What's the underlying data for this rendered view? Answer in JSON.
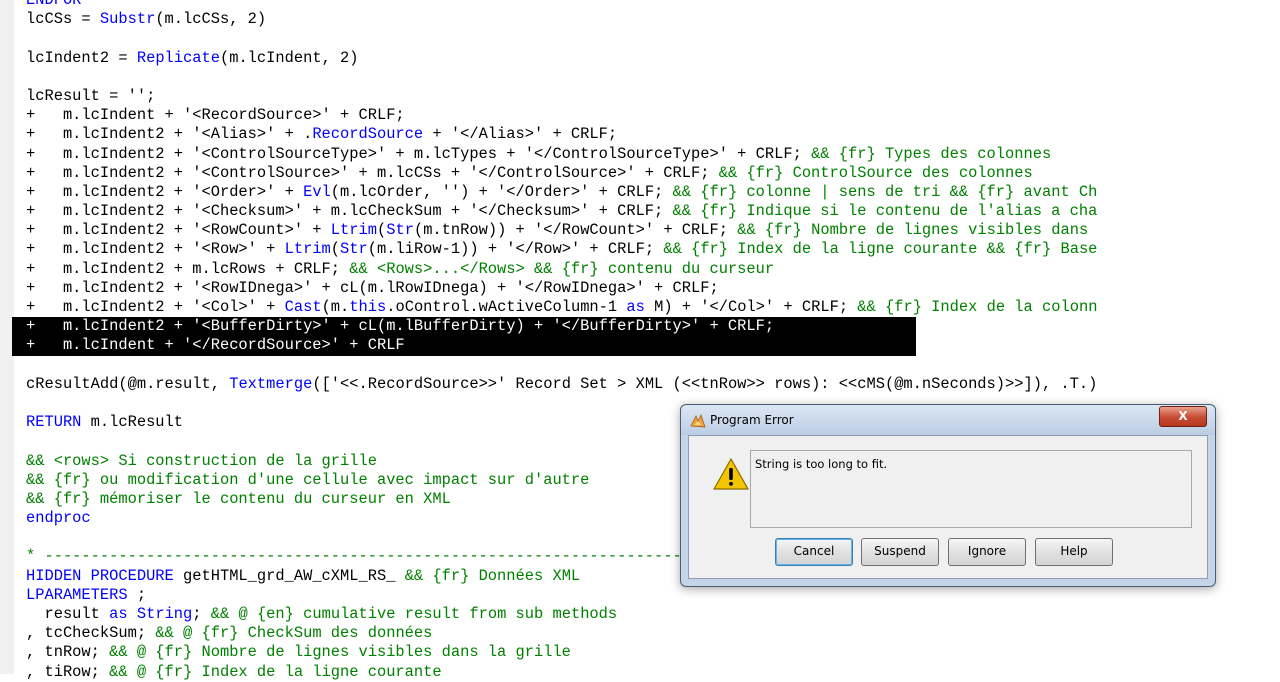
{
  "code_lines": [
    [
      {
        "t": "ENDFOR",
        "c": "kw"
      }
    ],
    [
      {
        "t": "lcCSs = "
      },
      {
        "t": "Substr",
        "c": "kw"
      },
      {
        "t": "(m.lcCSs, 2)"
      }
    ],
    [
      {
        "t": ""
      }
    ],
    [
      {
        "t": "lcIndent2 = "
      },
      {
        "t": "Replicate",
        "c": "kw"
      },
      {
        "t": "(m.lcIndent, 2)"
      }
    ],
    [
      {
        "t": ""
      }
    ],
    [
      {
        "t": "lcResult = '';"
      }
    ],
    [
      {
        "t": "+   m.lcIndent + '<RecordSource>' + CRLF;"
      }
    ],
    [
      {
        "t": "+   m.lcIndent2 + '<Alias>' + ."
      },
      {
        "t": "RecordSource",
        "c": "kw"
      },
      {
        "t": " + '</Alias>' + CRLF;"
      }
    ],
    [
      {
        "t": "+   m.lcIndent2 + '<ControlSourceType>' + m.lcTypes + '</ControlSourceType>' + CRLF; "
      },
      {
        "t": "&& {fr} Types des colonnes",
        "c": "cm"
      }
    ],
    [
      {
        "t": "+   m.lcIndent2 + '<ControlSource>' + m.lcCSs + '</ControlSource>' + CRLF; "
      },
      {
        "t": "&& {fr} ControlSource des colonnes",
        "c": "cm"
      }
    ],
    [
      {
        "t": "+   m.lcIndent2 + '<Order>' + "
      },
      {
        "t": "Evl",
        "c": "kw"
      },
      {
        "t": "(m.lcOrder, '') + '</Order>' + CRLF; "
      },
      {
        "t": "&& {fr} colonne | sens de tri && {fr} avant Ch",
        "c": "cm"
      }
    ],
    [
      {
        "t": "+   m.lcIndent2 + '<Checksum>' + m.lcCheckSum + '</Checksum>' + CRLF; "
      },
      {
        "t": "&& {fr} Indique si le contenu de l'alias a cha",
        "c": "cm"
      }
    ],
    [
      {
        "t": "+   m.lcIndent2 + '<RowCount>' + "
      },
      {
        "t": "Ltrim",
        "c": "kw"
      },
      {
        "t": "("
      },
      {
        "t": "Str",
        "c": "kw"
      },
      {
        "t": "(m.tnRow)) + '</RowCount>' + CRLF; "
      },
      {
        "t": "&& {fr} Nombre de lignes visibles dans",
        "c": "cm"
      }
    ],
    [
      {
        "t": "+   m.lcIndent2 + '<Row>' + "
      },
      {
        "t": "Ltrim",
        "c": "kw"
      },
      {
        "t": "("
      },
      {
        "t": "Str",
        "c": "kw"
      },
      {
        "t": "(m.liRow-1)) + '</Row>' + CRLF; "
      },
      {
        "t": "&& {fr} Index de la ligne courante && {fr} Base",
        "c": "cm"
      }
    ],
    [
      {
        "t": "+   m.lcIndent2 + m.lcRows + CRLF; "
      },
      {
        "t": "&& <Rows>...</Rows> && {fr} contenu du curseur",
        "c": "cm"
      }
    ],
    [
      {
        "t": "+   m.lcIndent2 + '<RowIDnega>' + cL(m.lRowIDnega) + '</RowIDnega>' + CRLF;"
      }
    ],
    [
      {
        "t": "+   m.lcIndent2 + '<Col>' + "
      },
      {
        "t": "Cast",
        "c": "kw"
      },
      {
        "t": "(m."
      },
      {
        "t": "this",
        "c": "kw"
      },
      {
        "t": ".oControl.wActiveColumn-1 "
      },
      {
        "t": "as",
        "c": "kw"
      },
      {
        "t": " M) + '</Col>' + CRLF; "
      },
      {
        "t": "&& {fr} Index de la colonn",
        "c": "cm"
      }
    ],
    [
      {
        "t": "+   m.lcIndent2 + '<BufferDirty>' + cL(m.lBufferDirty) + '</BufferDirty>' + CRLF;",
        "sel": true
      }
    ],
    [
      {
        "t": "+   m.lcIndent + '</RecordSource>' + CRLF",
        "sel": true
      }
    ],
    [
      {
        "t": ""
      }
    ],
    [
      {
        "t": "cResultAdd(@m.result, "
      },
      {
        "t": "Textmerge",
        "c": "kw"
      },
      {
        "t": "(['<<.RecordSource>>' Record Set > XML (<<tnRow>> rows): <<cMS(@m.nSeconds)>>]), .T.)"
      }
    ],
    [
      {
        "t": ""
      }
    ],
    [
      {
        "t": "RETURN",
        "c": "kw"
      },
      {
        "t": " m.lcResult"
      }
    ],
    [
      {
        "t": ""
      }
    ],
    [
      {
        "t": "&& <rows> Si construction de la grille",
        "c": "cm"
      }
    ],
    [
      {
        "t": "&& {fr} ou modification d'une cellule avec impact sur d'autre",
        "c": "cm"
      }
    ],
    [
      {
        "t": "&& {fr} mémoriser le contenu du curseur en XML",
        "c": "cm"
      }
    ],
    [
      {
        "t": "endproc",
        "c": "kw"
      }
    ],
    [
      {
        "t": ""
      }
    ],
    [
      {
        "t": "* -----------------------------------------------------------------------",
        "c": "cm"
      }
    ],
    [
      {
        "t": "HIDDEN PROCEDURE",
        "c": "kw"
      },
      {
        "t": " getHTML_grd_AW_cXML_RS_ "
      },
      {
        "t": "&& {fr} Données XML",
        "c": "cm"
      }
    ],
    [
      {
        "t": "LPARAMETERS",
        "c": "kw"
      },
      {
        "t": " ;"
      }
    ],
    [
      {
        "t": "  result "
      },
      {
        "t": "as",
        "c": "kw"
      },
      {
        "t": " "
      },
      {
        "t": "String",
        "c": "kw"
      },
      {
        "t": "; "
      },
      {
        "t": "&& @ {en} cumulative result from sub methods",
        "c": "cm"
      }
    ],
    [
      {
        "t": ", tcCheckSum; "
      },
      {
        "t": "&& @ {fr} CheckSum des données",
        "c": "cm"
      }
    ],
    [
      {
        "t": ", tnRow; "
      },
      {
        "t": "&& @ {fr} Nombre de lignes visibles dans la grille",
        "c": "cm"
      }
    ],
    [
      {
        "t": ", tiRow; "
      },
      {
        "t": "&& @ {fr} Index de la ligne courante",
        "c": "cm"
      }
    ]
  ],
  "dialog": {
    "title": "Program Error",
    "message": "String is too long to fit.",
    "buttons": {
      "cancel": "Cancel",
      "suspend": "Suspend",
      "ignore": "Ignore",
      "help": "Help"
    },
    "close_glyph": "X"
  },
  "icons": {
    "app": "foxpro-icon",
    "warning": "warning-icon"
  },
  "colors": {
    "keyword": "#0000ff",
    "comment": "#008000",
    "selection_bg": "#000000"
  }
}
